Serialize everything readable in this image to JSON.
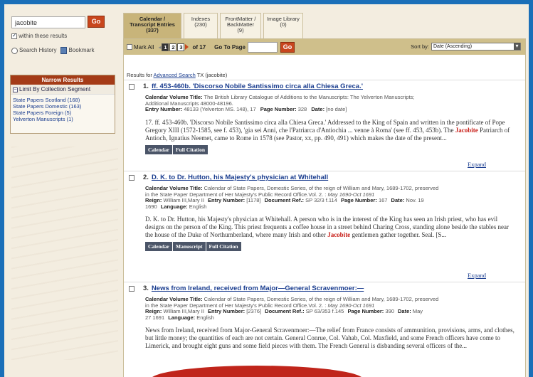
{
  "search": {
    "query": "jacobite",
    "go_label": "Go",
    "within_label": "within these results",
    "history_label": "Search History",
    "bookmark_label": "Bookmark"
  },
  "narrow": {
    "title": "Narrow Results",
    "limit_label": "Limit By Collection Segment",
    "items": [
      "State Papers Scotland (168)",
      "State Papers Domestic (163)",
      "State Papers Foreign (5)",
      "Yelverton Manuscripts (1)"
    ]
  },
  "tabs": [
    {
      "line1": "Calendar /",
      "line2": "Transcript Entries",
      "line3": "(337)"
    },
    {
      "line1": "Indexes",
      "line2": "(230)",
      "line3": ""
    },
    {
      "line1": "FrontMatter /",
      "line2": "BackMatter",
      "line3": "(9)"
    },
    {
      "line1": "Image Library",
      "line2": "(0)",
      "line3": ""
    }
  ],
  "toolbar": {
    "mark_all": "Mark All",
    "pages": [
      "1",
      "2",
      "3"
    ],
    "of_total": "of 17",
    "go_to_page": "Go To Page",
    "go_label": "Go",
    "sort_by": "Sort by:",
    "sort_value": "Date (Ascending)"
  },
  "results_for": {
    "prefix": "Results for",
    "link": "Advanced Search",
    "suffix": "TX (jacobite)"
  },
  "entries": [
    {
      "num": "1.",
      "title": "ff. 453-460b. 'Discorso Nobile Santissimo circa alla Chiesa Greca.'",
      "meta1_label": "Calendar Volume Title:",
      "meta1_val": "The British Library Catalogue of Additions to the Manuscripts: The Yelverton Manuscripts;",
      "meta2": "Additional Manuscripts 48000-48196.",
      "meta3_a_label": "Entry Number:",
      "meta3_a_val": "48133 (Yelverton MS. 148), 17",
      "meta3_b_label": "Page Number:",
      "meta3_b_val": "328",
      "meta3_c_label": "Date:",
      "meta3_c_val": "[no date]",
      "snippet_pre": "17. ff. 453-460b. 'Discorso Nobile Santissimo circa alla Chiesa Greca.' Addressed to the King of Spain and written in the pontificate of Pope Gregory XIII (1572-1585, see f. 453), 'gia sei Anni, che l'Patriarca d'Antiochia ... venne à Roma' (see ff. 453, 453b). The",
      "snippet_hl": "Jacobite",
      "snippet_post": "Patriarch of Antioch, Ignatius Neemet, came to Rome in 1578 (see Pastor, xx, pp. 490, 491) which makes the date of the present...",
      "buttons": [
        "Calendar",
        "Full Citation"
      ],
      "expand": "Expand"
    },
    {
      "num": "2.",
      "title": "D. K. to Dr. Hutton, his Majesty's physician at Whitehall",
      "meta1_label": "Calendar Volume Title:",
      "meta1_val": "Calendar of State Papers, Domestic Series, of the reign of William and Mary, 1689-1702, preserved",
      "meta2": "in the State Paper Department of Her Majesty's Public Record Office.Vol. 2. :",
      "meta2_ital": "May 1690-Oct 1691",
      "meta3_a_label": "Reign:",
      "meta3_a_val": "William III,Mary II",
      "meta3_b_label": "Entry Number:",
      "meta3_b_val": "[1178]",
      "meta3_c_label": "Document Ref.:",
      "meta3_c_val": "SP 32/3 f.114",
      "meta3_d_label": "Page Number:",
      "meta3_d_val": "167",
      "meta3_e_label": "Date:",
      "meta3_e_val": "Nov. 19",
      "meta4_val": "1690",
      "meta4_label": "Language:",
      "meta4_lang": "English",
      "snippet_pre": "D. K. to Dr. Hutton, his Majesty's physician at Whitehall. A person who is in the interest of the King has seen an Irish priest, who has evil designs on the person of the King. This priest frequents a coffee house in a street behind Charing Cross, standing alone beside the stables near the house of the Duke of Northumberland, where many Irish and other",
      "snippet_hl": "Jacobite",
      "snippet_post": "gentlemen gather together. Seal. [S...",
      "buttons": [
        "Calendar",
        "Manuscript",
        "Full Citation"
      ],
      "expand": "Expand"
    },
    {
      "num": "3.",
      "title": "News from Ireland, received from Major—General Scravenmoer:—",
      "meta1_label": "Calendar Volume Title:",
      "meta1_val": "Calendar of State Papers, Domestic Series, of the reign of William and Mary, 1689-1702, preserved",
      "meta2": "in the State Paper Department of Her Majesty's Public Record Office.Vol. 2. :",
      "meta2_ital": "May 1690-Oct 1691",
      "meta3_a_label": "Reign:",
      "meta3_a_val": "William III,Mary II",
      "meta3_b_label": "Entry Number:",
      "meta3_b_val": "[2376]",
      "meta3_c_label": "Document Ref.:",
      "meta3_c_val": "SP 63/353 f.145",
      "meta3_d_label": "Page Number:",
      "meta3_d_val": "390",
      "meta3_e_label": "Date:",
      "meta3_e_val": "May",
      "meta4_val": "27 1691",
      "meta4_label": "Language:",
      "meta4_lang": "English",
      "snippet_pre": "News from Ireland, received from Major-General Scravenmoer:—The relief from France consists of ammunition, provisions, arms, and clothes, but little money; the quantities of each are not certain. General Conrue, Col. Vahab, Col. Maxfield, and some French officers have come to Limerick, and brought eight guns and some field pieces with them. The French General is disbanding several officers of the..."
    }
  ]
}
